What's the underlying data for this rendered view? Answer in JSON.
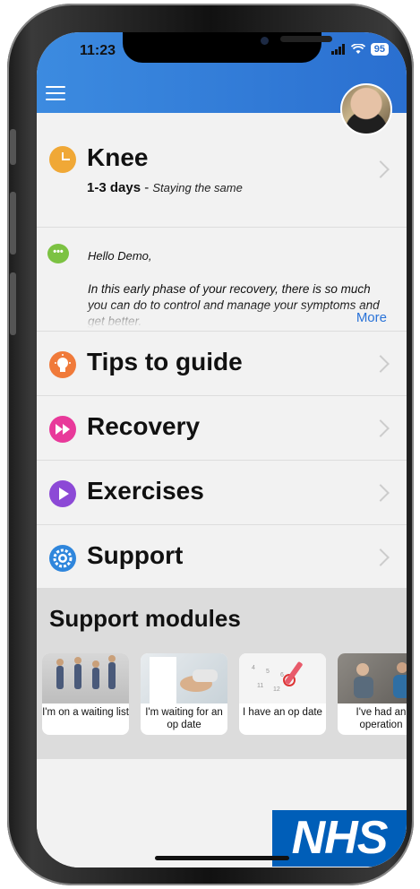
{
  "status_bar": {
    "time": "11:23",
    "battery": "95"
  },
  "header": {
    "title": "Knee",
    "duration": "1-3 days",
    "separator": " - ",
    "trend": "Staying the same"
  },
  "message": {
    "greeting": "Hello Demo,",
    "body": "In this early phase of your recovery, there is so much you can do to control and manage your symptoms and get better.",
    "more_label": "More"
  },
  "menu": [
    {
      "label": "Tips to guide",
      "icon": "lightbulb-icon",
      "color": "#f07a3a"
    },
    {
      "label": "Recovery",
      "icon": "fast-forward-icon",
      "color": "#e8399a"
    },
    {
      "label": "Exercises",
      "icon": "play-icon",
      "color": "#8c49d6"
    },
    {
      "label": "Support",
      "icon": "gear-icon",
      "color": "#2f86dc"
    }
  ],
  "support_modules": {
    "title": "Support modules",
    "items": [
      {
        "caption": "I'm on a waiting list"
      },
      {
        "caption": "I'm waiting for an op date"
      },
      {
        "caption": "I have an op date"
      },
      {
        "caption": "I've had an operation"
      }
    ]
  },
  "logo": {
    "text": "NHS",
    "color": "#005eb8"
  },
  "colors": {
    "header_blue": "#3c8be0",
    "link": "#2a73d8",
    "clock": "#f0a836",
    "chat": "#7cc242"
  }
}
